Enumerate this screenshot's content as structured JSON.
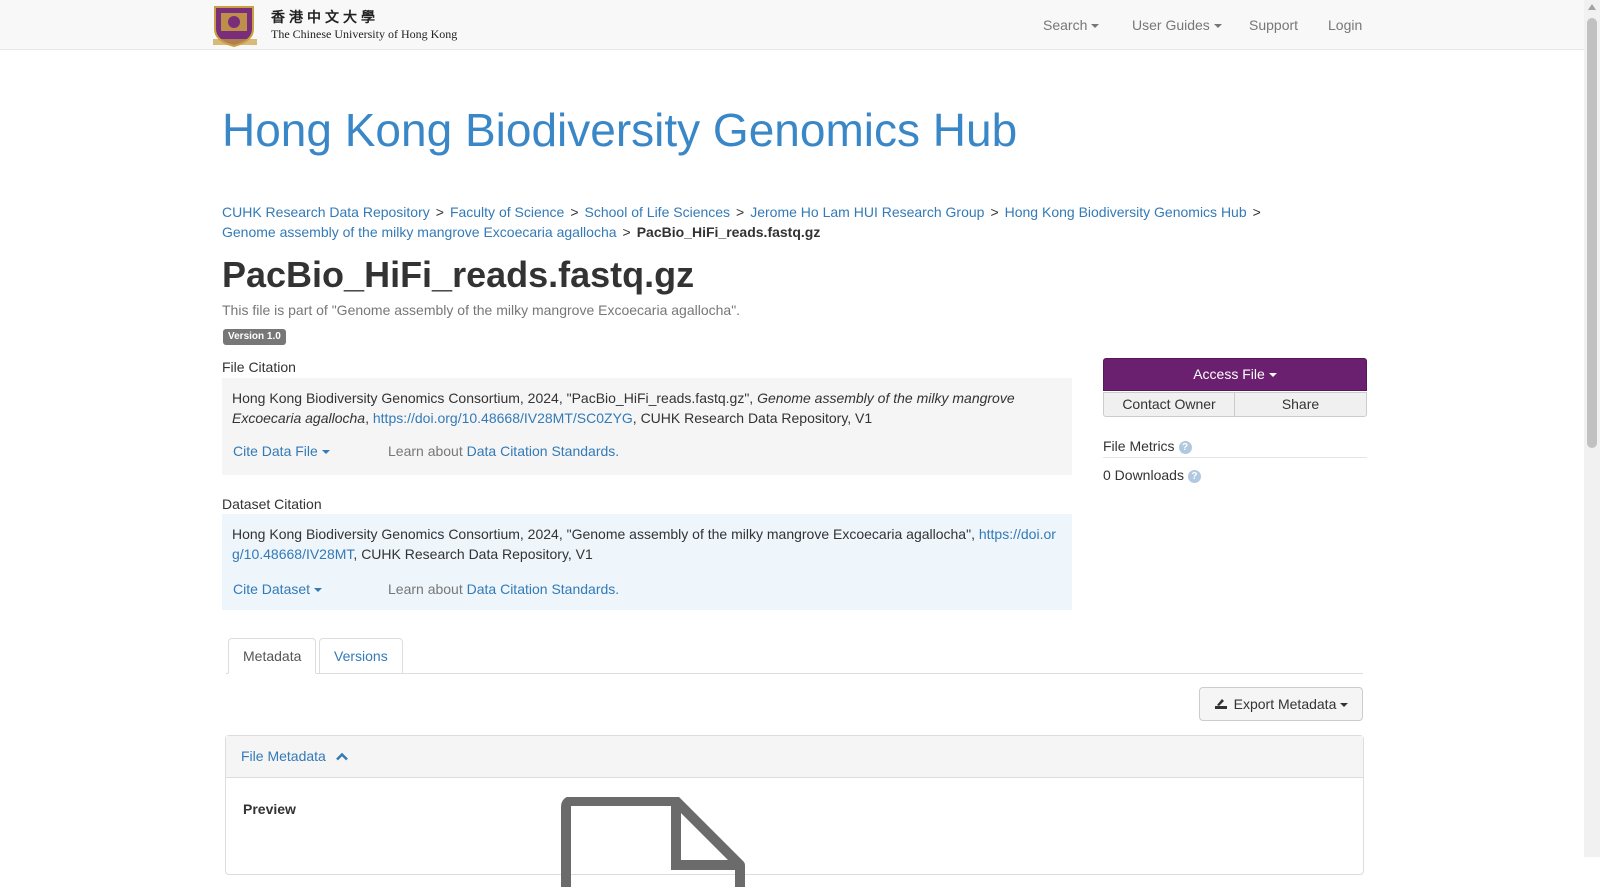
{
  "nav": {
    "logo_chinese": "香港中文大學",
    "logo_english": "The Chinese University of Hong Kong",
    "search": "Search",
    "user_guides": "User Guides",
    "support": "Support",
    "login": "Login"
  },
  "hub_title": "Hong Kong Biodiversity Genomics Hub",
  "breadcrumb": [
    "CUHK Research Data Repository",
    "Faculty of Science",
    "School of Life Sciences",
    "Jerome Ho Lam HUI Research Group",
    "Hong Kong Biodiversity Genomics Hub",
    "Genome assembly of the milky mangrove Excoecaria agallocha",
    "PacBio_HiFi_reads.fastq.gz"
  ],
  "file_title": "PacBio_HiFi_reads.fastq.gz",
  "subtitle": "This file is part of \"Genome assembly of the milky mangrove Excoecaria agallocha\".",
  "version_badge": "Version 1.0",
  "file_citation": {
    "label": "File Citation",
    "text_pre": "Hong Kong Biodiversity Genomics Consortium, 2024, \"PacBio_HiFi_reads.fastq.gz\", ",
    "italic": "Genome assembly of the milky mangrove Excoecaria agallocha",
    "comma": ", ",
    "doi": "https://doi.org/10.48668/IV28MT/SC0ZYG",
    "text_post": ", CUHK Research Data Repository, V1",
    "cite_button": "Cite Data File",
    "learn_text": "Learn about ",
    "learn_link": "Data Citation Standards."
  },
  "dataset_citation": {
    "label": "Dataset Citation",
    "text_pre": "Hong Kong Biodiversity Genomics Consortium, 2024, \"Genome assembly of the milky mangrove Excoecaria agallocha\", ",
    "doi_line1": "https://doi.or",
    "doi_line2": "g/10.48668/IV28MT",
    "text_post": ", CUHK Research Data Repository, V1",
    "cite_button": "Cite Dataset",
    "learn_text": "Learn about ",
    "learn_link": "Data Citation Standards."
  },
  "actions": {
    "access_file": "Access File",
    "contact_owner": "Contact Owner",
    "share": "Share",
    "file_metrics": "File Metrics",
    "downloads": "0 Downloads"
  },
  "tabs": [
    "Metadata",
    "Versions"
  ],
  "export_metadata": "Export Metadata",
  "panel": {
    "title": "File Metadata",
    "preview_label": "Preview"
  },
  "colors": {
    "link": "#337ab7",
    "hub_title": "#3a87c8",
    "access_button": "#6b1f6f",
    "file_citation_bg": "#f5f5f5",
    "dataset_citation_bg": "#eef5fb"
  }
}
